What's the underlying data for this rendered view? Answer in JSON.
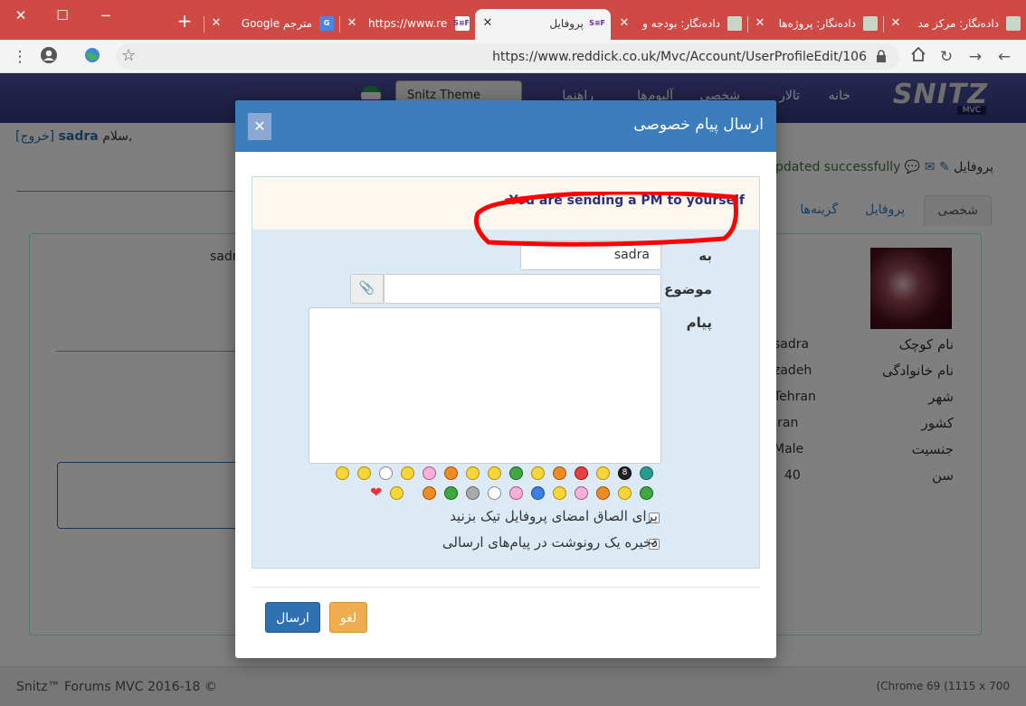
{
  "browser": {
    "tabs": [
      {
        "title": "داده‌نگار: مرکز مد",
        "icon": "news-favicon-icon",
        "active": false
      },
      {
        "title": "داده‌نگار: پروژه‌ها",
        "icon": "news-favicon-icon",
        "active": false
      },
      {
        "title": "داده‌نگار: بودجه و",
        "icon": "news-favicon-icon",
        "active": false
      },
      {
        "title": "پروفایل",
        "icon": "snitz-favicon-icon",
        "favicon_text": "S≡F",
        "active": true
      },
      {
        "title": "https://www.red",
        "icon": "snitz-favicon-icon",
        "favicon_text": "S≡F",
        "active": false
      },
      {
        "title": "مترجم Google",
        "icon": "google-translate-icon",
        "favicon_text": "G",
        "active": false
      }
    ],
    "url": "https://www.reddick.co.uk/Mvc/Account/UserProfileEdit/106"
  },
  "navbar": {
    "logo_text": "SNITZ",
    "logo_sub": "MVC",
    "items": [
      "خانه",
      "تالار",
      "شخصی",
      "آلبوم‌ها",
      "راهنما"
    ],
    "theme": "Snitz Theme"
  },
  "greeting": {
    "hello": "سلام,",
    "username": "sadra",
    "logout": "[خروج]"
  },
  "profile": {
    "breadcrumb": "پروفایل",
    "status": "updated successfully",
    "tabs": [
      "شخصی",
      "پروفایل",
      "گزینه‌ها"
    ],
    "fields": [
      {
        "label": "نام کوچک",
        "value": "sadra"
      },
      {
        "label": "نام خانوادگی",
        "value": "zadeh"
      },
      {
        "label": "شهر",
        "value": "Tehran"
      },
      {
        "label": "کشور",
        "value": "Iran"
      },
      {
        "label": "جنسیت",
        "value": "Male"
      },
      {
        "label": "سن",
        "value": "40"
      }
    ],
    "side_text": "sadra"
  },
  "footer": {
    "left": "Snitz™ Forums MVC 2016-18 ©",
    "right": "(Chrome 69 (1115 x 700"
  },
  "modal": {
    "title": "ارسال پیام خصوصی",
    "warning": "You are sending a PM to yourself",
    "to_label": "به",
    "to_value": "sadra",
    "subject_label": "موضوع",
    "subject_value": "",
    "message_label": "پیام",
    "message_value": "",
    "signature_label": "برای الصاق امضای پروفایل تیک بزنید",
    "signature_checked": false,
    "save_label": "ذخیره یک رونوشت در پیام‌های ارسالی",
    "save_checked": true,
    "send_button": "ارسال",
    "cancel_button": "لغو",
    "smileys_row1": [
      "smile",
      "cool",
      "clown",
      "smile",
      "blush",
      "grin",
      "nerd",
      "big-grin",
      "sick",
      "sleepy",
      "angry",
      "angry-red",
      "smile",
      "eight-ball",
      "question"
    ],
    "smileys_row2": [
      "heart",
      "thumbs-up",
      "tongue",
      "happy-devil",
      "sick",
      "dead",
      "kiss",
      "shocked",
      "sad",
      "wink",
      "happy",
      "evil",
      "sad",
      "sick"
    ],
    "accent_color": "#3c7dbd"
  }
}
